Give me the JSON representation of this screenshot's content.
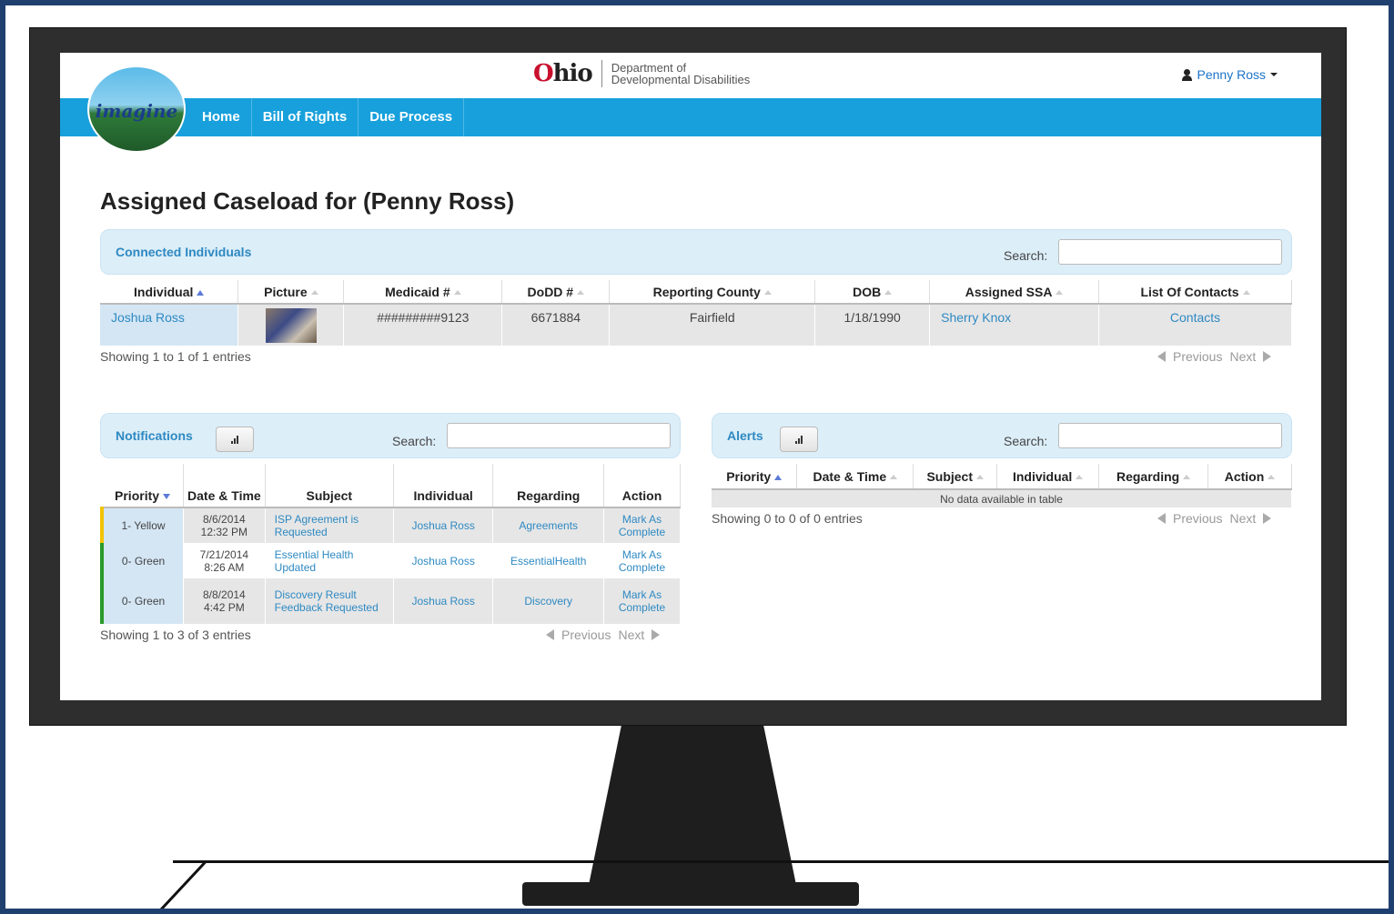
{
  "header": {
    "ohio_logo": "Ohio",
    "department_line1": "Department of",
    "department_line2": "Developmental Disabilities",
    "user_name": "Penny Ross"
  },
  "nav": {
    "logo_text": "imagine",
    "items": [
      {
        "label": "Home"
      },
      {
        "label": "Bill of Rights"
      },
      {
        "label": "Due Process"
      }
    ]
  },
  "page_title": "Assigned Caseload for (Penny Ross)",
  "connected": {
    "title": "Connected Individuals",
    "search_label": "Search:",
    "columns": [
      "Individual",
      "Picture",
      "Medicaid #",
      "DoDD #",
      "Reporting County",
      "DOB",
      "Assigned SSA",
      "List Of Contacts"
    ],
    "rows": [
      {
        "individual": "Joshua Ross",
        "medicaid": "#########9123",
        "dodd": "6671884",
        "county": "Fairfield",
        "dob": "1/18/1990",
        "ssa": "Sherry Knox",
        "contacts": "Contacts"
      }
    ],
    "info": "Showing 1 to 1 of 1 entries",
    "previous": "Previous",
    "next": "Next"
  },
  "notifications": {
    "title": "Notifications",
    "search_label": "Search:",
    "columns": [
      "Priority",
      "Date & Time",
      "Subject",
      "Individual",
      "Regarding",
      "Action"
    ],
    "rows": [
      {
        "priority": "1- Yellow",
        "date": "8/6/2014",
        "time": "12:32 PM",
        "subject": "ISP Agreement is Requested",
        "individual": "Joshua Ross",
        "regarding": "Agreements",
        "action": "Mark As Complete",
        "color": "#f2c300"
      },
      {
        "priority": "0- Green",
        "date": "7/21/2014",
        "time": "8:26 AM",
        "subject": "Essential Health Updated",
        "individual": "Joshua Ross",
        "regarding": "EssentialHealth",
        "action": "Mark As Complete",
        "color": "#2a9a2a"
      },
      {
        "priority": "0- Green",
        "date": "8/8/2014",
        "time": "4:42 PM",
        "subject": "Discovery Result Feedback Requested",
        "individual": "Joshua Ross",
        "regarding": "Discovery",
        "action": "Mark As Complete",
        "color": "#2a9a2a"
      }
    ],
    "info": "Showing 1 to 3 of 3 entries",
    "previous": "Previous",
    "next": "Next"
  },
  "alerts": {
    "title": "Alerts",
    "search_label": "Search:",
    "columns": [
      "Priority",
      "Date & Time",
      "Subject",
      "Individual",
      "Regarding",
      "Action"
    ],
    "empty": "No data available in table",
    "info": "Showing 0 to 0 of 0 entries",
    "previous": "Previous",
    "next": "Next"
  },
  "colors": {
    "nav_blue": "#17a0dc",
    "panel_bg": "#dceef8",
    "link": "#2e89c2",
    "frame": "#1f3f6e"
  }
}
